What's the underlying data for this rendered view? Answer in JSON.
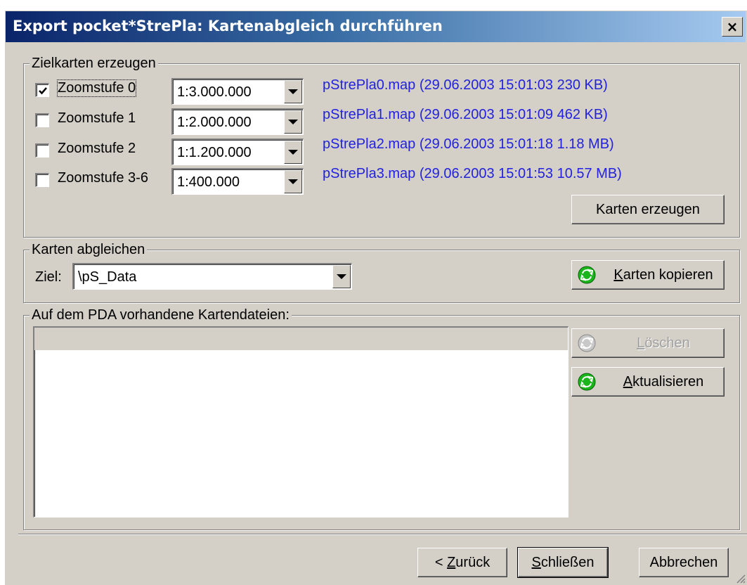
{
  "window": {
    "title": "Export pocket*StrePla: Kartenabgleich durchführen",
    "close_label": "×"
  },
  "zielkarten": {
    "legend": "Zielkarten erzeugen",
    "rows": [
      {
        "label": "Zoomstufe 0",
        "checked": true,
        "scale": "1:3.000.000",
        "info": "pStrePla0.map (29.06.2003 15:01:03 230 KB)"
      },
      {
        "label": "Zoomstufe 1",
        "checked": false,
        "scale": "1:2.000.000",
        "info": "pStrePla1.map (29.06.2003 15:01:09 462 KB)"
      },
      {
        "label": "Zoomstufe 2",
        "checked": false,
        "scale": "1:1.200.000",
        "info": "pStrePla2.map (29.06.2003 15:01:18 1.18 MB)"
      },
      {
        "label": "Zoomstufe 3-6",
        "checked": false,
        "scale": "1:400.000",
        "info": "pStrePla3.map (29.06.2003 15:01:53 10.57 MB)"
      }
    ],
    "button_label": "Karten erzeugen"
  },
  "abgleich": {
    "legend": "Karten abgleichen",
    "target_label": "Ziel:",
    "target_value": "\\pS_Data",
    "copy_button": {
      "accel": "K",
      "rest": "arten kopieren"
    }
  },
  "pda": {
    "legend": "Auf dem PDA vorhandene Kartendateien:",
    "delete_button": {
      "accel": "L",
      "rest": "öschen"
    },
    "refresh_button": {
      "accel": "A",
      "rest": "ktualisieren"
    }
  },
  "footer": {
    "back": {
      "pre": "< ",
      "accel": "Z",
      "rest": "urück"
    },
    "close": {
      "accel": "S",
      "rest": "chließen"
    },
    "cancel": "Abbrechen"
  },
  "colors": {
    "face": "#d4d0c8",
    "link": "#2222dd",
    "title_start": "#0a246a",
    "title_end": "#a6caf0",
    "icon_green": "#19b51a"
  }
}
